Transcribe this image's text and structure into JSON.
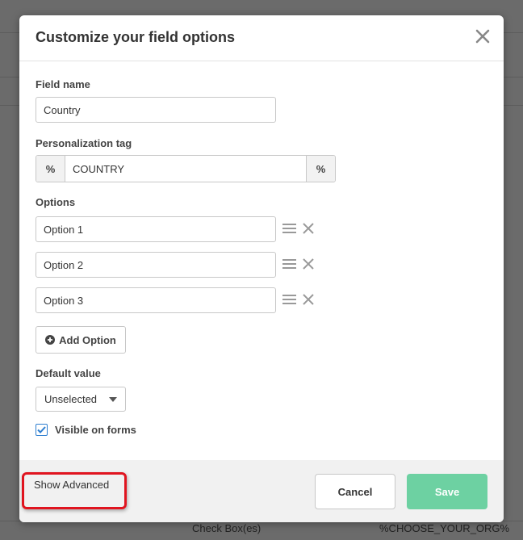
{
  "modal": {
    "title": "Customize your field options"
  },
  "field_name": {
    "label": "Field name",
    "value": "Country"
  },
  "personalization": {
    "label": "Personalization tag",
    "prefix": "%",
    "value": "COUNTRY",
    "suffix": "%"
  },
  "options": {
    "label": "Options",
    "items": [
      "Option 1",
      "Option 2",
      "Option 3"
    ],
    "add_label": "Add Option"
  },
  "default_value": {
    "label": "Default value",
    "selected": "Unselected"
  },
  "visible": {
    "label": "Visible on forms",
    "checked": true
  },
  "footer": {
    "show_advanced": "Show Advanced",
    "cancel": "Cancel",
    "save": "Save"
  },
  "background": {
    "cell_type": "Check Box(es)",
    "cell_tag": "%CHOOSE_YOUR_ORG%"
  },
  "colors": {
    "save_button": "#6dd1a2",
    "highlight": "#e0141f",
    "checkbox": "#2f7fd0"
  },
  "icons": [
    "close-icon",
    "drag-handle-icon",
    "remove-icon",
    "plus-circle-icon",
    "caret-down-icon",
    "checkmark-icon"
  ]
}
